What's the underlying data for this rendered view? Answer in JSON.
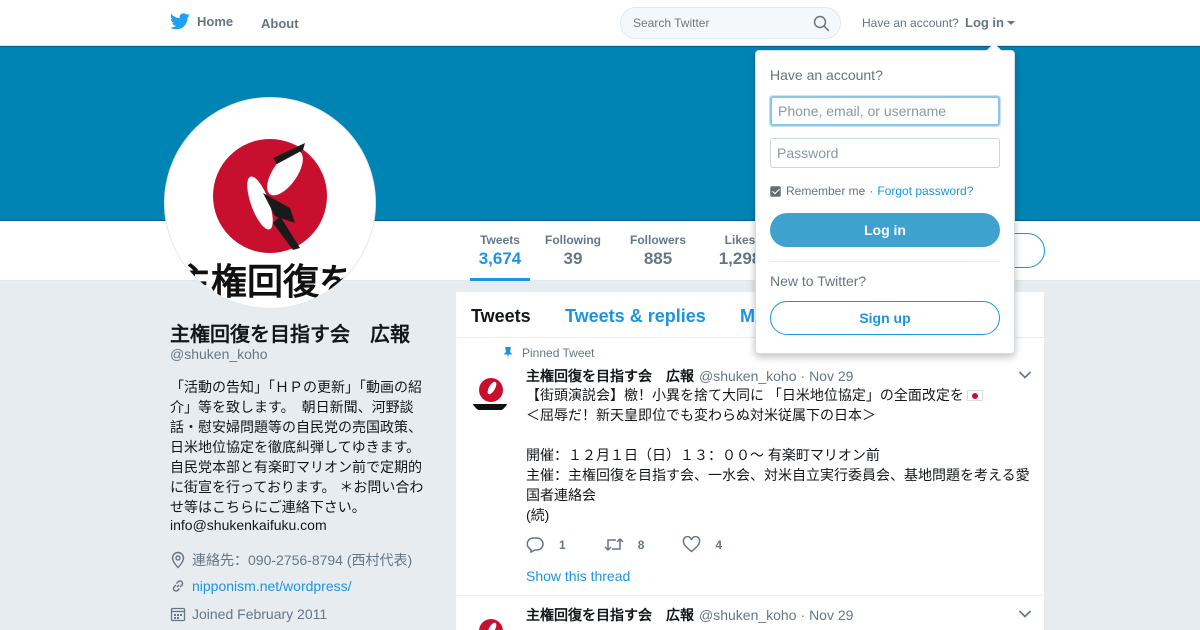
{
  "nav": {
    "home_label": "Home",
    "about_label": "About",
    "search_placeholder": "Search Twitter",
    "have_account": "Have an account?",
    "login_label": "Log in"
  },
  "colors": {
    "banner": "#0084b4",
    "accent": "#1b95e0",
    "login_button": "#3ea1ce",
    "logo_red": "#c8102e"
  },
  "avatar_logo": {
    "text": "主権回復を"
  },
  "stats": [
    {
      "label": "Tweets",
      "value": "3,674"
    },
    {
      "label": "Following",
      "value": "39"
    },
    {
      "label": "Followers",
      "value": "885"
    },
    {
      "label": "Likes",
      "value": "1,298"
    }
  ],
  "profile": {
    "name": "主権回復を目指す会　広報",
    "handle": "@shuken_koho",
    "bio": "「活動の告知」「ＨＰの更新」「動画の紹介」等を致します。　朝日新聞、河野談話・慰安婦問題等の自民党の売国政策、日米地位協定を徹底糾弾してゆきます。　自民党本部と有楽町マリオン前で定期的に街宣を行っております。 ＊お問い合わせ等はこちらにご連絡下さい。",
    "email": "info@shukenkaifuku.com",
    "location": "連絡先：090-2756-8794 (西村代表)",
    "website": "nipponism.net/wordpress/",
    "joined": "Joined February 2011"
  },
  "timeline": {
    "tabs": [
      "Tweets",
      "Tweets & replies",
      "M"
    ],
    "tweets": [
      {
        "pinned_label": "Pinned Tweet",
        "name": "主権回復を目指す会　広報",
        "handle": "@shuken_koho",
        "time": "· Nov 29",
        "text_title": "【街頭演説会】檄！小異を捨て大同に 「日米地位協定」の全面改定を",
        "text": "＜屈辱だ！新天皇即位でも変わらぬ対米従属下の日本＞\n\n開催：１２月１日（日）１３：００～ 有楽町マリオン前\n主催：主権回復を目指す会、一水会、対米自立実行委員会、基地問題を考える愛国者連絡会\n(続)",
        "replies": "1",
        "retweets": "8",
        "likes": "4",
        "thread_label": "Show this thread"
      },
      {
        "name": "主権回復を目指す会　広報",
        "handle": "@shuken_koho",
        "time": "· Nov 29"
      }
    ]
  },
  "login_dropdown": {
    "title": "Have an account?",
    "username_placeholder": "Phone, email, or username",
    "password_placeholder": "Password",
    "remember_label": "Remember me",
    "separator": "·",
    "forgot_label": "Forgot password?",
    "login_button": "Log in",
    "new_label": "New to Twitter?",
    "signup_button": "Sign up"
  }
}
